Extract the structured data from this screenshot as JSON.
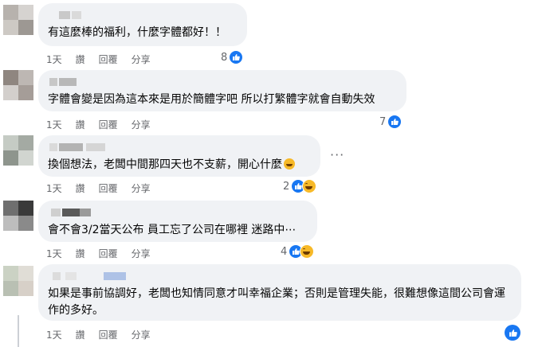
{
  "comments": [
    {
      "text": "有這麼棒的福利，什麼字體都好！！",
      "actions": [
        "1天",
        "讚",
        "回覆",
        "分享"
      ],
      "reaction_count": "8",
      "reactions": [
        "like-icon"
      ]
    },
    {
      "text": "字體會變是因為這本來是用於簡體字吧 所以打繁體字就會自動失效",
      "actions": [
        "1天",
        "讚",
        "回覆",
        "分享"
      ],
      "reaction_count": "7",
      "reactions": [
        "like-icon"
      ]
    },
    {
      "text": "換個想法，老闆中間那四天也不支薪，開心什麼",
      "actions": [
        "1天",
        "讚",
        "回覆",
        "分享"
      ],
      "reaction_count": "2",
      "reactions": [
        "like-icon",
        "haha-icon"
      ]
    },
    {
      "text": "會不會3/2當天公布 員工忘了公司在哪裡 迷路中⋯",
      "actions": [
        "1天",
        "讚",
        "回覆",
        "分享"
      ],
      "reaction_count": "4",
      "reactions": [
        "like-icon",
        "haha-icon"
      ]
    },
    {
      "text": "如果是事前協調好，老闆也知情同意才叫幸福企業；否則是管理失能，很難想像這間公司會運作的多好。",
      "actions": [
        "1天",
        "讚",
        "回覆",
        "分享"
      ]
    }
  ],
  "more_label": "···",
  "colors": {
    "bubble": "#f0f2f5",
    "meta": "#65676b",
    "like": "#1877f2",
    "haha": "#f7b928"
  }
}
